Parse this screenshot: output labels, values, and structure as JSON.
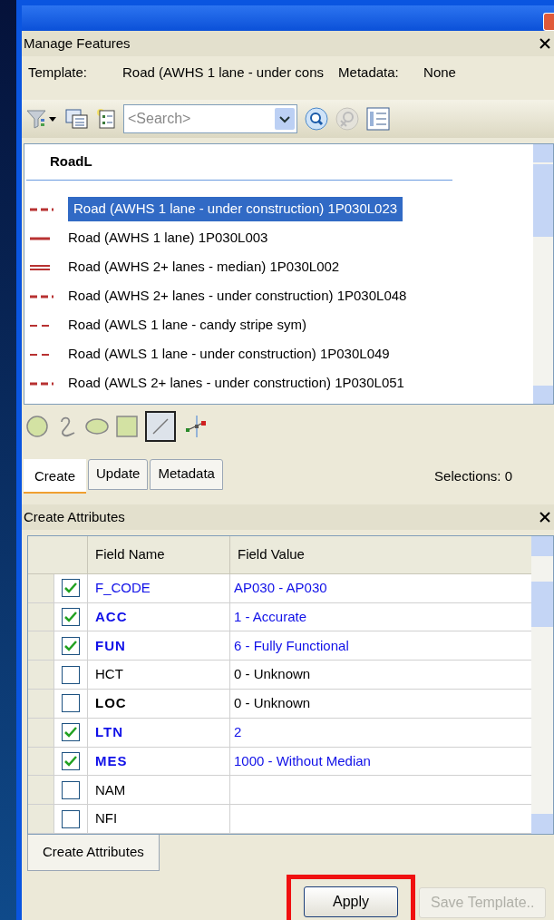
{
  "panel": {
    "title": "Manage Features",
    "template_label": "Template:",
    "template_value": "Road (AWHS 1 lane - under cons",
    "metadata_label": "Metadata:",
    "metadata_value": "None"
  },
  "search": {
    "placeholder": "<Search>"
  },
  "layer": {
    "name": "RoadL"
  },
  "templates": [
    {
      "label": "Road (AWHS 1 lane - under construction) 1P030L023",
      "kind": "dashed",
      "selected": true
    },
    {
      "label": "Road (AWHS 1 lane) 1P030L003",
      "kind": "solid",
      "selected": false
    },
    {
      "label": "Road (AWHS 2+ lanes - median) 1P030L002",
      "kind": "double",
      "selected": false
    },
    {
      "label": "Road (AWHS 2+ lanes - under construction) 1P030L048",
      "kind": "dashed",
      "selected": false
    },
    {
      "label": "Road (AWLS 1 lane - candy stripe sym)",
      "kind": "thin-dashed",
      "selected": false
    },
    {
      "label": "Road (AWLS 1 lane - under construction) 1P030L049",
      "kind": "thin-dashed",
      "selected": false
    },
    {
      "label": "Road (AWLS 2+ lanes - under construction) 1P030L051",
      "kind": "dashed",
      "selected": false
    }
  ],
  "tools": [
    {
      "kind": "circle",
      "selected": false
    },
    {
      "kind": "freehand",
      "selected": false
    },
    {
      "kind": "ellipse",
      "selected": false
    },
    {
      "kind": "rectangle",
      "selected": false
    },
    {
      "kind": "line",
      "selected": true
    },
    {
      "kind": "point",
      "selected": false
    }
  ],
  "tabs": [
    {
      "label": "Create",
      "selected": true
    },
    {
      "label": "Update",
      "selected": false
    },
    {
      "label": "Metadata",
      "selected": false
    }
  ],
  "selections": "Selections: 0",
  "attributes": {
    "title": "Create Attributes",
    "columns": [
      "Field Name",
      "Field Value"
    ],
    "rows": [
      {
        "name": "F_CODE",
        "value": "AP030 - AP030",
        "checked": true,
        "required": false
      },
      {
        "name": "ACC",
        "value": "1 - Accurate",
        "checked": true,
        "required": true
      },
      {
        "name": "FUN",
        "value": "6 - Fully Functional",
        "checked": true,
        "required": true
      },
      {
        "name": "HCT",
        "value": "0 - Unknown",
        "checked": false,
        "required": false
      },
      {
        "name": "LOC",
        "value": "0 - Unknown",
        "checked": false,
        "required": true
      },
      {
        "name": "LTN",
        "value": "2",
        "checked": true,
        "required": true
      },
      {
        "name": "MES",
        "value": "1000 - Without Median",
        "checked": true,
        "required": true
      },
      {
        "name": "NAM",
        "value": null,
        "checked": false,
        "required": false
      },
      {
        "name": "NFI",
        "value": null,
        "checked": false,
        "required": false
      }
    ],
    "tab": "Create Attributes"
  },
  "buttons": [
    {
      "label": "Apply",
      "disabled": false,
      "highlighted": true
    },
    {
      "label": "Save Template..",
      "disabled": true,
      "highlighted": false
    }
  ]
}
